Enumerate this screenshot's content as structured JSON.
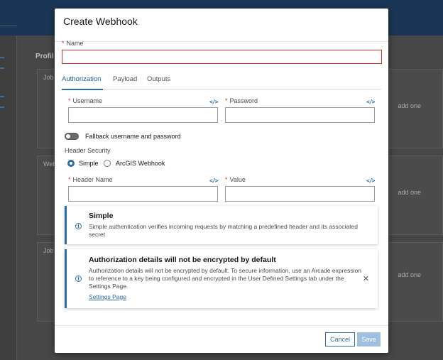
{
  "background": {
    "profile_label": "Profil",
    "card1_title": "Job",
    "card2_title": "Web",
    "card3_title": "Job",
    "add_one_text": "add one"
  },
  "dialog": {
    "title": "Create Webhook",
    "name": {
      "label": "Name",
      "value": "",
      "placeholder": ""
    },
    "tabs": [
      {
        "label": "Authorization",
        "active": true
      },
      {
        "label": "Payload",
        "active": false
      },
      {
        "label": "Outputs",
        "active": false
      }
    ],
    "username": {
      "label": "Username",
      "value": ""
    },
    "password": {
      "label": "Password",
      "value": ""
    },
    "fallback_toggle": {
      "label": "Fallback username and password",
      "on": false
    },
    "header_security": {
      "label": "Header Security",
      "options": [
        {
          "label": "Simple",
          "checked": true
        },
        {
          "label": "ArcGIS Webhook",
          "checked": false
        }
      ]
    },
    "header_name": {
      "label": "Header Name",
      "value": ""
    },
    "header_value": {
      "label": "Value",
      "value": ""
    },
    "notice_simple": {
      "title": "Simple",
      "body": "Simple authentication verifies incoming requests by matching a predefined header and its associated secret"
    },
    "notice_encryption": {
      "title": "Authorization details will not be encrypted by default",
      "body": "Authorization details will not be encrypted by default. To secure information, use an Arcade expression to reference to a key being configured and encrypted in the User Defined Settings tab under the Settings Page.",
      "link": "Settings Page"
    },
    "buttons": {
      "cancel": "Cancel",
      "save": "Save"
    }
  },
  "colors": {
    "accent": "#2a6ea8",
    "required": "#d83020",
    "save_disabled": "#9ec0de"
  },
  "icons": {
    "code": "code-icon",
    "info": "info-icon",
    "close": "close-icon"
  }
}
